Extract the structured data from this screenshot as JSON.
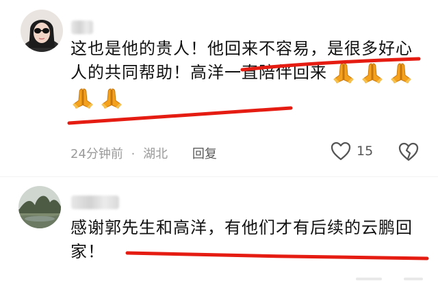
{
  "comments": [
    {
      "text_lines": [
        "这也是他的贵人！他回来不容易，是很多好心",
        "人的共同帮助！高洋一直陪伴回来"
      ],
      "emoji_count_line2": 3,
      "emoji_count_line3": 2,
      "time": "24分钟前",
      "separator": "·",
      "location": "湖北",
      "reply_label": "回复",
      "like_count": "15"
    },
    {
      "text_lines": [
        "感谢郭先生和高洋，有他们才有后续的云鹏回",
        "家！"
      ]
    }
  ],
  "colors": {
    "underline": "#e41c12",
    "emoji": "#f4a11e"
  },
  "icons": [
    "heart-outline-icon",
    "broken-heart-icon",
    "praying-hands-icon"
  ]
}
